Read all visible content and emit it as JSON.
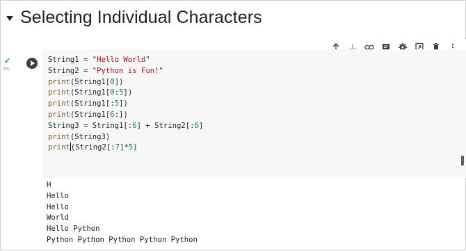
{
  "section": {
    "title": "Selecting Individual Characters"
  },
  "cell": {
    "status_icon": "check-icon",
    "exec_time": "0s",
    "run_icon": "play-icon",
    "code_lines": [
      "String1 = \"Hello World\"",
      "String2 = \"Python is Fun!\"",
      "print(String1[0])",
      "print(String1[0:5])",
      "print(String1[:5])",
      "print(String1[6:])",
      "String3 = String1[:6] + String2[:6]",
      "print(String3)",
      "print(String2[:7]*5)"
    ],
    "output_lines": [
      "H",
      "Hello",
      "Hello",
      "World",
      "Hello Python",
      "Python Python Python Python Python"
    ]
  },
  "toolbar": {
    "icons": [
      "arrow-up-icon",
      "arrow-down-icon",
      "link-icon",
      "comment-icon",
      "settings-icon",
      "mirror-cell-icon",
      "delete-icon",
      "more-icon"
    ]
  },
  "colors": {
    "string": "#a31515",
    "number": "#098658",
    "builtin": "#795e26",
    "editor_bg": "#f7f7f7",
    "success": "#1e8e3e"
  }
}
